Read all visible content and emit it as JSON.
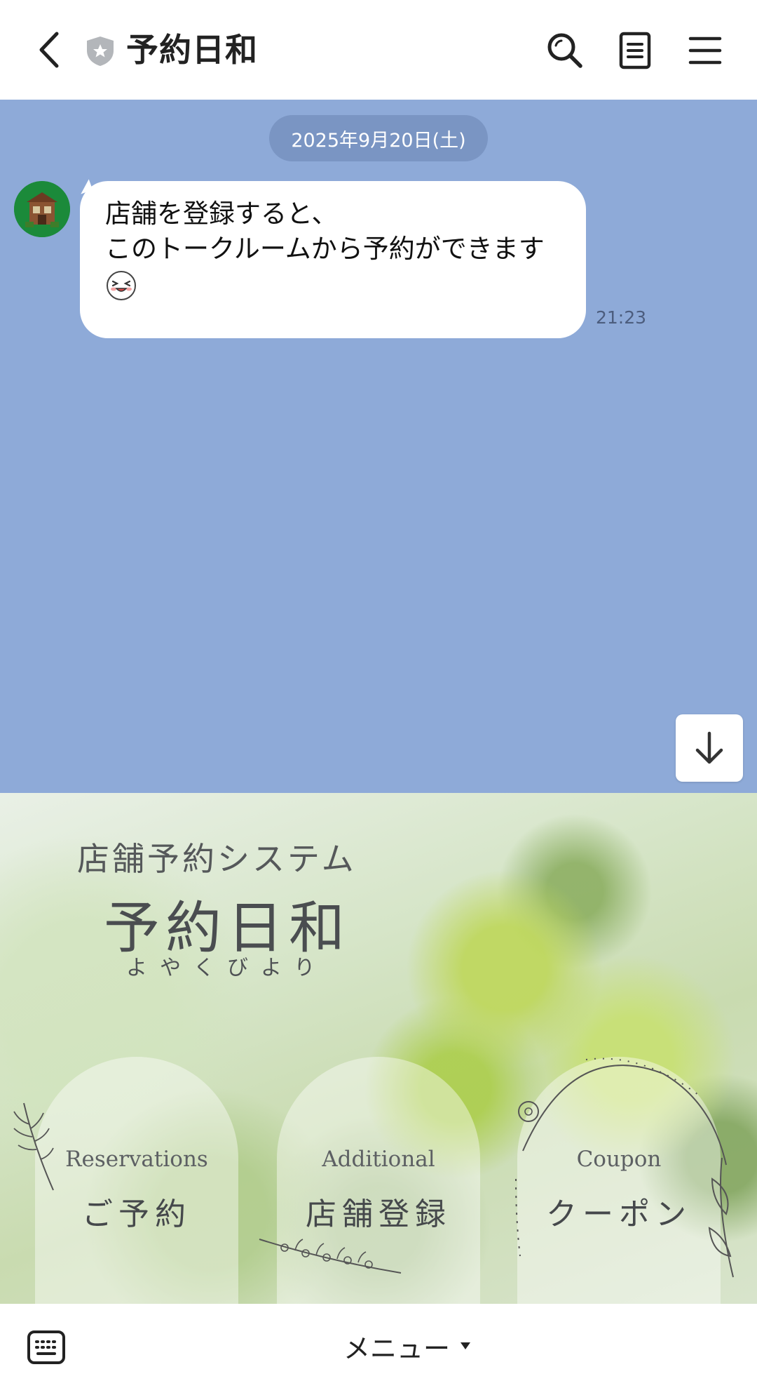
{
  "header": {
    "title": "予約日和",
    "icons": [
      "back-icon",
      "shield-icon",
      "search-icon",
      "notes-icon",
      "menu-icon"
    ]
  },
  "chat": {
    "date": "2025年9月20日(土)",
    "messages": [
      {
        "lines": [
          "店舗を登録すると、",
          "このトークルームから予約ができます"
        ],
        "emoji": "laughing-face-emoji",
        "time": "21:23"
      }
    ]
  },
  "rich_menu": {
    "subtitle": "店舗予約システム",
    "title": "予約日和",
    "reading": "よやくびより",
    "buttons": [
      {
        "en": "Reservations",
        "jp": "ご予約"
      },
      {
        "en": "Additional",
        "jp": "店舗登録"
      },
      {
        "en": "Coupon",
        "jp": "クーポン"
      }
    ]
  },
  "bottom_bar": {
    "menu_label": "メニュー"
  },
  "colors": {
    "chat_background": "#8eaad8",
    "date_pill": "#7a95c3",
    "avatar_background": "#1b8a3a"
  }
}
